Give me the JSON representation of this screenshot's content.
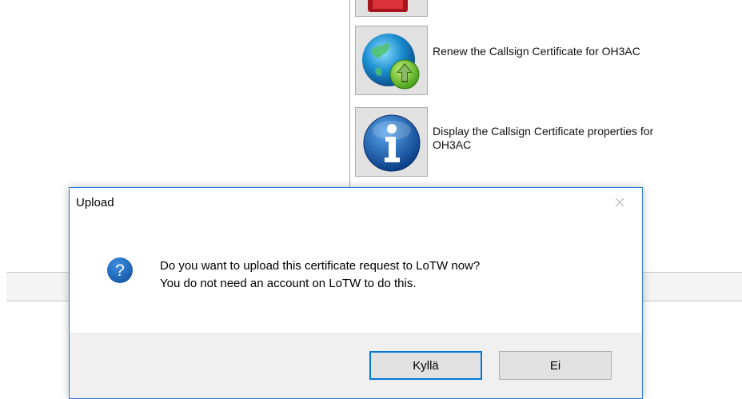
{
  "background": {
    "tiles": [
      {
        "id": "top",
        "icon": "red-certificate-icon",
        "label": ""
      },
      {
        "id": "renew",
        "icon": "globe-upload-icon",
        "label": "Renew the Callsign Certificate for OH3AC"
      },
      {
        "id": "info",
        "icon": "info-icon",
        "label_line1": "Display the Callsign Certificate properties for",
        "label_line2": "OH3AC"
      }
    ]
  },
  "dialog": {
    "title": "Upload",
    "close_icon": "close-icon",
    "question_icon": "question-icon",
    "message_line1": "Do you want to upload this certificate request to LoTW now?",
    "message_line2": "You do not need an account on LoTW to do this.",
    "buttons": {
      "yes": "Kyllä",
      "no": "Ei"
    },
    "accent": "#0078d7"
  }
}
